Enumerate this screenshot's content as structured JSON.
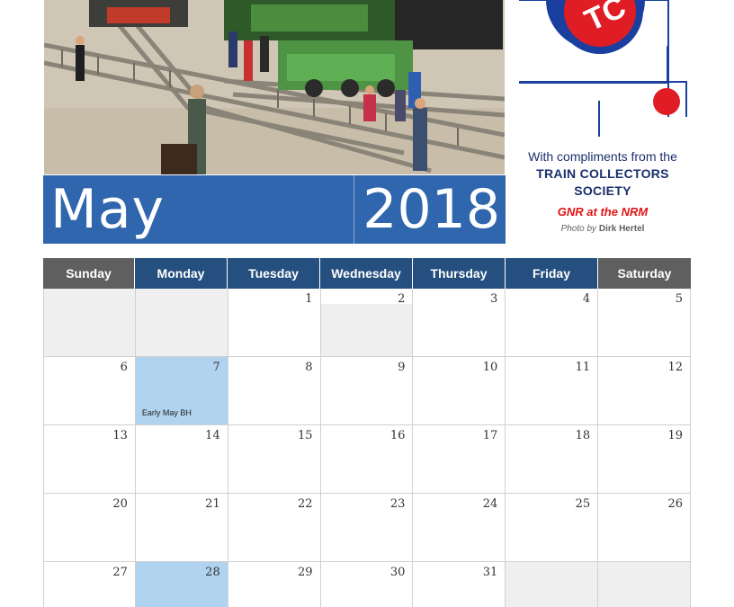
{
  "banner": {
    "month": "May",
    "year": "2018"
  },
  "sidebar": {
    "compliments": "With compliments from the",
    "society_line1": "TRAIN COLLECTORS",
    "society_line2": "SOCIETY",
    "gnr": "GNR at the NRM",
    "photo_by": "Photo by",
    "photographer": "Dirk Hertel",
    "logo_text": "TC"
  },
  "colors": {
    "banner": "#2f66ad",
    "weekday_header": "#254f7e",
    "weekend_header": "#5f5f5f",
    "holiday": "#b0d3f0",
    "accent_red": "#e01414"
  },
  "calendar": {
    "headers": [
      "Sunday",
      "Monday",
      "Tuesday",
      "Wednesday",
      "Thursday",
      "Friday",
      "Saturday"
    ],
    "weeks": [
      [
        {
          "d": ""
        },
        {
          "d": ""
        },
        {
          "d": "1"
        },
        {
          "d": "2"
        },
        {
          "d": "3"
        },
        {
          "d": "4"
        },
        {
          "d": "5"
        }
      ],
      [
        {
          "d": "6"
        },
        {
          "d": "7",
          "note": "Early May BH"
        },
        {
          "d": "8"
        },
        {
          "d": "9"
        },
        {
          "d": "10"
        },
        {
          "d": "11"
        },
        {
          "d": "12"
        }
      ],
      [
        {
          "d": "13"
        },
        {
          "d": "14"
        },
        {
          "d": "15"
        },
        {
          "d": "16"
        },
        {
          "d": "17"
        },
        {
          "d": "18"
        },
        {
          "d": "19"
        }
      ],
      [
        {
          "d": "20"
        },
        {
          "d": "21"
        },
        {
          "d": "22"
        },
        {
          "d": "23"
        },
        {
          "d": "24"
        },
        {
          "d": "25"
        },
        {
          "d": "26"
        }
      ],
      [
        {
          "d": "27"
        },
        {
          "d": "28"
        },
        {
          "d": "29"
        },
        {
          "d": "30"
        },
        {
          "d": "31"
        },
        {
          "d": ""
        },
        {
          "d": ""
        }
      ]
    ]
  }
}
